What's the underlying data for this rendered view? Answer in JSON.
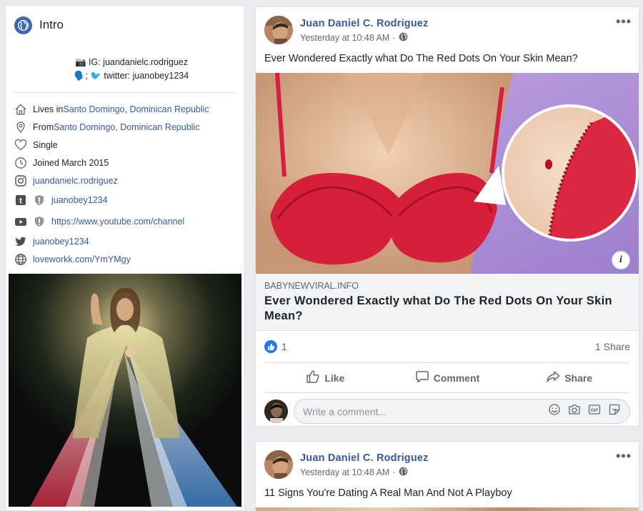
{
  "intro": {
    "title": "Intro",
    "bio": {
      "line1": "📷 IG: juandanielc.rodriguez",
      "line2": "🗣️; 🐦 twitter: juanobey1234"
    },
    "items": [
      {
        "icon": "home-icon",
        "prefix": "Lives in ",
        "link": "Santo Domingo, Dominican Republic"
      },
      {
        "icon": "location-pin-icon",
        "prefix": "From ",
        "link": "Santo Domingo, Dominican Republic"
      },
      {
        "icon": "heart-icon",
        "text": "Single"
      },
      {
        "icon": "clock-icon",
        "text": "Joined March 2015"
      },
      {
        "icon": "instagram-icon",
        "link": "juandanielc.rodriguez"
      },
      {
        "icon": "tumblr-icon",
        "link": "juanobey1234"
      },
      {
        "icon": "youtube-icon",
        "link": "https://www.youtube.com/channel"
      },
      {
        "icon": "twitter-icon",
        "link": "juanobey1234"
      },
      {
        "icon": "globe-icon",
        "link": "loveworkk.com/YmYMgy"
      }
    ]
  },
  "posts": [
    {
      "author": "Juan Daniel C. Rodriguez",
      "time": "Yesterday at 10:48 AM",
      "separator": "·",
      "text": "Ever Wondered Exactly what Do The Red Dots On Your Skin Mean?",
      "link": {
        "domain": "BABYNEWVIRAL.INFO",
        "title": "Ever Wondered Exactly what Do The Red Dots On Your Skin Mean?",
        "info_glyph": "i"
      },
      "reaction_count": "1",
      "shares": "1 Share",
      "actions": {
        "like": "Like",
        "comment": "Comment",
        "share": "Share"
      },
      "comment_placeholder": "Write a comment..."
    },
    {
      "author": "Juan Daniel C. Rodriguez",
      "time": "Yesterday at 10:48 AM",
      "separator": "·",
      "text": "11 Signs You're Dating A Real Man And Not A Playboy"
    }
  ],
  "colors": {
    "link": "#385898",
    "accent": "#4267b2",
    "like": "#2078f4"
  }
}
